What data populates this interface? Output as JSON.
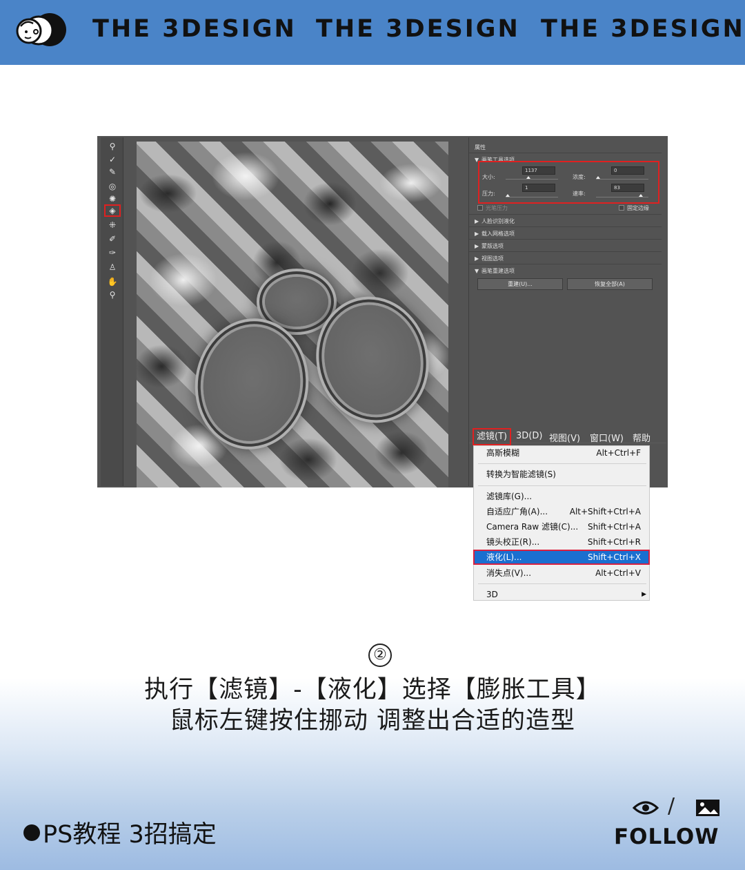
{
  "banner": {
    "brand": [
      "THE 3DESIGN",
      "THE 3DESIGN",
      "THE 3DESIGN"
    ],
    "bg_color": "#4a84c8"
  },
  "toolbar": {
    "tools": [
      {
        "name": "forward-warp-icon",
        "glyph": "⚲"
      },
      {
        "name": "reconstruct-icon",
        "glyph": "✓"
      },
      {
        "name": "smooth-icon",
        "glyph": "✎"
      },
      {
        "name": "twirl-icon",
        "glyph": "◎"
      },
      {
        "name": "pucker-icon",
        "glyph": "✺"
      },
      {
        "name": "bloat-icon",
        "glyph": "◈",
        "selected": true
      },
      {
        "name": "push-left-icon",
        "glyph": "⁜"
      },
      {
        "name": "freeze-mask-icon",
        "glyph": "✐"
      },
      {
        "name": "thaw-mask-icon",
        "glyph": "✑"
      },
      {
        "name": "face-tool-icon",
        "glyph": "♙"
      },
      {
        "name": "hand-icon",
        "glyph": "✋"
      },
      {
        "name": "zoom-icon",
        "glyph": "⚲"
      }
    ]
  },
  "properties": {
    "title": "属性",
    "brush_tool_options": "画笔工具选项",
    "size_label": "大小:",
    "size_value": "1137",
    "density_label": "浓度:",
    "density_value": "0",
    "pressure_label": "压力:",
    "pressure_value": "1",
    "rate_label": "速率:",
    "rate_value": "83",
    "stylus_pressure": "光笔压力",
    "pin_edges": "固定边缘",
    "sections": [
      "人脸识别液化",
      "载入网格选项",
      "蒙版选项",
      "视图选项",
      "画笔重建选项"
    ],
    "reconstruct_button": "重建(U)...",
    "restore_all_button": "恢复全部(A)"
  },
  "menubar": {
    "items": [
      "滤镜(T)",
      "3D(D)",
      "视图(V)",
      "窗口(W)",
      "帮助"
    ]
  },
  "filter_menu": {
    "items": [
      {
        "label": "高斯模糊",
        "shortcut": "Alt+Ctrl+F"
      },
      {
        "label": "转换为智能滤镜(S)",
        "shortcut": ""
      },
      {
        "label": "滤镜库(G)...",
        "shortcut": ""
      },
      {
        "label": "自适应广角(A)...",
        "shortcut": "Alt+Shift+Ctrl+A"
      },
      {
        "label": "Camera Raw 滤镜(C)...",
        "shortcut": "Shift+Ctrl+A"
      },
      {
        "label": "镜头校正(R)...",
        "shortcut": "Shift+Ctrl+R"
      },
      {
        "label": "液化(L)...",
        "shortcut": "Shift+Ctrl+X"
      },
      {
        "label": "消失点(V)...",
        "shortcut": "Alt+Ctrl+V"
      },
      {
        "label": "3D",
        "shortcut": ""
      }
    ],
    "highlight_color": "#1a6fd0"
  },
  "caption": {
    "step": "②",
    "line1": "执行【滤镜】-【液化】选择【膨胀工具】",
    "line2": "鼠标左键按住挪动  调整出合适的造型"
  },
  "footer": {
    "text": "PS教程 3招搞定",
    "slash": "/",
    "follow": "FOLLOW"
  }
}
